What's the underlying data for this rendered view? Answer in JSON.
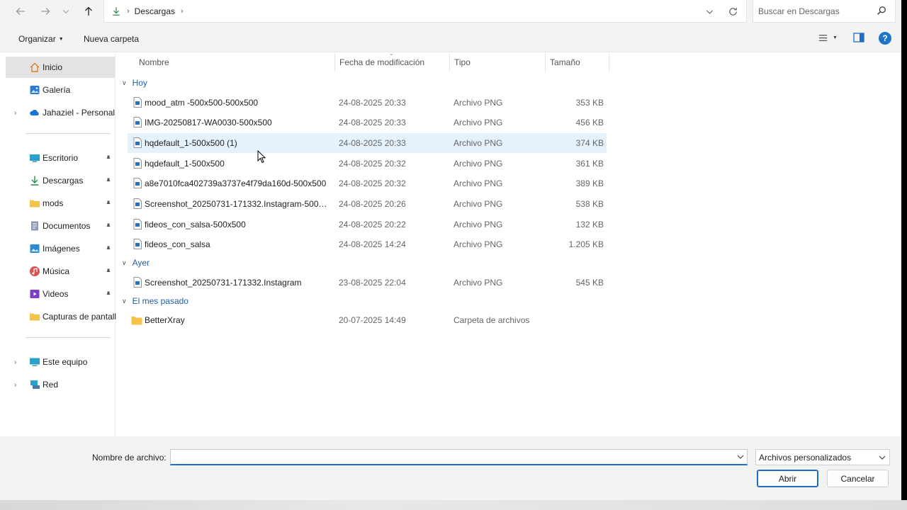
{
  "addressbar": {
    "crumbs": [
      "Descargas"
    ],
    "search_placeholder": "Buscar en Descargas"
  },
  "toolbar": {
    "organize_label": "Organizar",
    "new_folder_label": "Nueva carpeta"
  },
  "sidebar": {
    "items": [
      {
        "label": "Inicio",
        "icon": "home-icon",
        "selected": true
      },
      {
        "label": "Galería",
        "icon": "gallery-icon"
      },
      {
        "label": "Jahaziel - Personal",
        "icon": "onedrive-icon",
        "expandable": true
      },
      {
        "label": "Escritorio",
        "icon": "desktop-icon",
        "pinned": true
      },
      {
        "label": "Descargas",
        "icon": "download-icon",
        "pinned": true
      },
      {
        "label": "mods",
        "icon": "folder-icon",
        "pinned": true
      },
      {
        "label": "Documentos",
        "icon": "documents-icon",
        "pinned": true
      },
      {
        "label": "Imágenes",
        "icon": "pictures-icon",
        "pinned": true
      },
      {
        "label": "Música",
        "icon": "music-icon",
        "pinned": true
      },
      {
        "label": "Videos",
        "icon": "videos-icon",
        "pinned": true
      },
      {
        "label": "Capturas de pantalla",
        "icon": "folder-icon"
      },
      {
        "label": "Este equipo",
        "icon": "this-pc-icon",
        "expandable": true
      },
      {
        "label": "Red",
        "icon": "network-icon",
        "expandable": true
      }
    ]
  },
  "columns": {
    "name": "Nombre",
    "date": "Fecha de modificación",
    "type": "Tipo",
    "size": "Tamaño"
  },
  "groups": [
    {
      "label": "Hoy",
      "files": [
        {
          "name": "mood_atm -500x500-500x500",
          "date": "24-08-2025 20:33",
          "type": "Archivo PNG",
          "size": "353 KB",
          "icon": "image-file-icon"
        },
        {
          "name": "IMG-20250817-WA0030-500x500",
          "date": "24-08-2025 20:33",
          "type": "Archivo PNG",
          "size": "456 KB",
          "icon": "image-file-icon"
        },
        {
          "name": "hqdefault_1-500x500 (1)",
          "date": "24-08-2025 20:33",
          "type": "Archivo PNG",
          "size": "374 KB",
          "icon": "image-file-icon",
          "hover": true
        },
        {
          "name": "hqdefault_1-500x500",
          "date": "24-08-2025 20:32",
          "type": "Archivo PNG",
          "size": "361 KB",
          "icon": "image-file-icon"
        },
        {
          "name": "a8e7010fca402739a3737e4f79da160d-500x500",
          "date": "24-08-2025 20:32",
          "type": "Archivo PNG",
          "size": "389 KB",
          "icon": "image-file-icon"
        },
        {
          "name": "Screenshot_20250731-171332.Instagram-500x...",
          "date": "24-08-2025 20:26",
          "type": "Archivo PNG",
          "size": "538 KB",
          "icon": "image-file-icon"
        },
        {
          "name": "fideos_con_salsa-500x500",
          "date": "24-08-2025 20:22",
          "type": "Archivo PNG",
          "size": "132 KB",
          "icon": "image-file-icon"
        },
        {
          "name": "fideos_con_salsa",
          "date": "24-08-2025 14:24",
          "type": "Archivo PNG",
          "size": "1.205 KB",
          "icon": "image-file-icon"
        }
      ]
    },
    {
      "label": "Ayer",
      "files": [
        {
          "name": "Screenshot_20250731-171332.Instagram",
          "date": "23-08-2025 22:04",
          "type": "Archivo PNG",
          "size": "545 KB",
          "icon": "image-file-icon"
        }
      ]
    },
    {
      "label": "El mes pasado",
      "files": [
        {
          "name": "BetterXray",
          "date": "20-07-2025 14:49",
          "type": "Carpeta de archivos",
          "size": "",
          "icon": "folder-icon"
        }
      ]
    }
  ],
  "footer": {
    "filename_label": "Nombre de archivo:",
    "filename_value": "",
    "filter_value": "Archivos personalizados",
    "open_label": "Abrir",
    "cancel_label": "Cancelar"
  }
}
